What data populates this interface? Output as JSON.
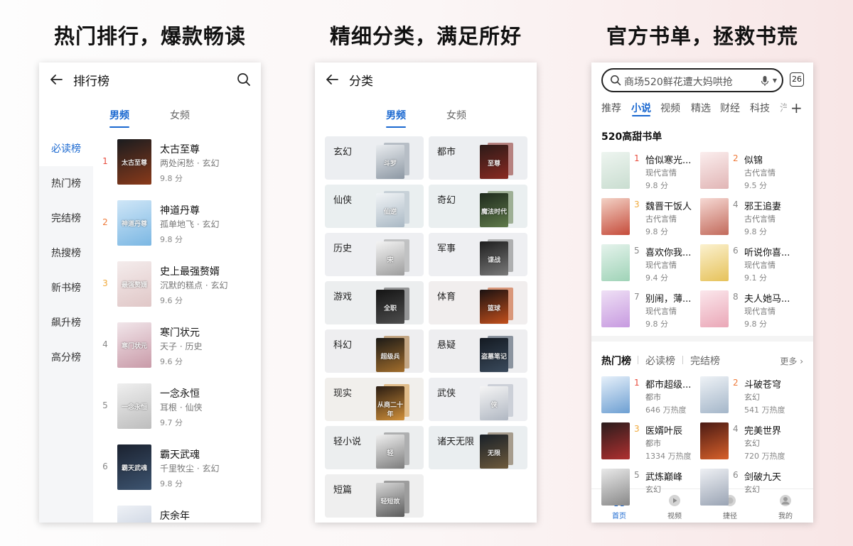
{
  "headlines": [
    "热门排行，爆款畅读",
    "精细分类，满足所好",
    "官方书单，拯救书荒"
  ],
  "ranking": {
    "title": "排行榜",
    "tabs": [
      "男频",
      "女频"
    ],
    "sidebar": [
      "必读榜",
      "热门榜",
      "完结榜",
      "热搜榜",
      "新书榜",
      "飙升榜",
      "高分榜"
    ],
    "books": [
      {
        "rank": "1",
        "title": "太古至尊",
        "meta": "两处闲愁 · 玄幻",
        "score": "9.8 分",
        "cover_text": "太古至尊",
        "colors": [
          "#1a1c1f",
          "#8a3a1a"
        ]
      },
      {
        "rank": "2",
        "title": "神道丹尊",
        "meta": "孤单地飞 · 玄幻",
        "score": "9.8 分",
        "cover_text": "神道丹尊",
        "colors": [
          "#cfe6f7",
          "#7bb7e3"
        ]
      },
      {
        "rank": "3",
        "title": "史上最强赘婿",
        "meta": "沉默的糕点 · 玄幻",
        "score": "9.6 分",
        "cover_text": "最强赘婿",
        "colors": [
          "#f4ecec",
          "#e0c7c7"
        ]
      },
      {
        "rank": "4",
        "title": "寒门状元",
        "meta": "天子 · 历史",
        "score": "9.6 分",
        "cover_text": "寒门状元",
        "colors": [
          "#f1e6ea",
          "#c99aa8"
        ]
      },
      {
        "rank": "5",
        "title": "一念永恒",
        "meta": "耳根 · 仙侠",
        "score": "9.7 分",
        "cover_text": "一念永恒",
        "colors": [
          "#efefef",
          "#bdbdbd"
        ]
      },
      {
        "rank": "6",
        "title": "霸天武魂",
        "meta": "千里牧尘 · 玄幻",
        "score": "9.8 分",
        "cover_text": "霸天武魂",
        "colors": [
          "#1b2230",
          "#3d5470"
        ]
      },
      {
        "rank": "",
        "title": "庆余年",
        "meta": "",
        "score": "",
        "cover_text": "庆余年",
        "colors": [
          "#eef1f6",
          "#b9c4d6"
        ]
      }
    ]
  },
  "category": {
    "title": "分类",
    "tabs": [
      "男频",
      "女频"
    ],
    "items": [
      {
        "name": "玄幻",
        "bg": "#eceef1",
        "cover_text": "斗罗",
        "colors": [
          "#e9ecef",
          "#8c97a3"
        ]
      },
      {
        "name": "都市",
        "bg": "#eceef1",
        "cover_text": "至尊",
        "colors": [
          "#2b1a18",
          "#8a2a22"
        ]
      },
      {
        "name": "仙侠",
        "bg": "#eaeff0",
        "cover_text": "仙逆",
        "colors": [
          "#f1f4f6",
          "#a9b8c4"
        ]
      },
      {
        "name": "奇幻",
        "bg": "#eaeff0",
        "cover_text": "魔法时代",
        "colors": [
          "#1e2a1d",
          "#5f7a4a"
        ]
      },
      {
        "name": "历史",
        "bg": "#eeeff2",
        "cover_text": "宋",
        "colors": [
          "#f3f3f3",
          "#9d9d9d"
        ]
      },
      {
        "name": "军事",
        "bg": "#eeeff2",
        "cover_text": "谍战",
        "colors": [
          "#1e1e1e",
          "#7a7a7a"
        ]
      },
      {
        "name": "游戏",
        "bg": "#eceeef",
        "cover_text": "全职",
        "colors": [
          "#141414",
          "#4e4e4e"
        ]
      },
      {
        "name": "体育",
        "bg": "#f1eeee",
        "cover_text": "篮球",
        "colors": [
          "#1a1111",
          "#c4501c"
        ]
      },
      {
        "name": "科幻",
        "bg": "#eeeef0",
        "cover_text": "超级兵",
        "colors": [
          "#1c1a17",
          "#a36e2c"
        ]
      },
      {
        "name": "悬疑",
        "bg": "#eeeef0",
        "cover_text": "盗墓笔记",
        "colors": [
          "#141a22",
          "#3a4a5c"
        ]
      },
      {
        "name": "现实",
        "bg": "#f1efec",
        "cover_text": "从商二十年",
        "colors": [
          "#2a1c12",
          "#d2913a"
        ]
      },
      {
        "name": "武侠",
        "bg": "#eeeff2",
        "cover_text": "侠",
        "colors": [
          "#f5f5f5",
          "#b0b7c2"
        ]
      },
      {
        "name": "轻小说",
        "bg": "#eceeef",
        "cover_text": "轻",
        "colors": [
          "#f0f0f0",
          "#7c7c7c"
        ]
      },
      {
        "name": "诸天无限",
        "bg": "#eaeef0",
        "cover_text": "无限",
        "colors": [
          "#182028",
          "#6e5a3c"
        ]
      },
      {
        "name": "短篇",
        "bg": "#efefef",
        "cover_text": "轻短故",
        "colors": [
          "#d8d8d8",
          "#5a5a5a"
        ]
      }
    ]
  },
  "store": {
    "search_text": "商场520鲜花遭大妈哄抢",
    "day_badge": "26",
    "tabs": [
      "推荐",
      "小说",
      "视频",
      "精选",
      "财经",
      "科技",
      "汽"
    ],
    "active_tab": 1,
    "section_title": "520高甜书单",
    "sweet_books": [
      {
        "rank": "1",
        "title": "恰似寒光...",
        "meta": "现代言情",
        "score": "9.8 分",
        "colors": [
          "#eef5f0",
          "#c9ddd0"
        ]
      },
      {
        "rank": "2",
        "title": "似锦",
        "meta": "古代言情",
        "score": "9.5 分",
        "colors": [
          "#fbeeee",
          "#e1b5b5"
        ]
      },
      {
        "rank": "3",
        "title": "魏晋干饭人",
        "meta": "古代言情",
        "score": "9.8 分",
        "colors": [
          "#f3d2c6",
          "#c54b3a"
        ]
      },
      {
        "rank": "4",
        "title": "邪王追妻",
        "meta": "古代言情",
        "score": "9.8 分",
        "colors": [
          "#f6d9d4",
          "#c26a5b"
        ]
      },
      {
        "rank": "5",
        "title": "喜欢你我...",
        "meta": "现代言情",
        "score": "9.4 分",
        "colors": [
          "#e5f3ec",
          "#9fd3b7"
        ]
      },
      {
        "rank": "6",
        "title": "听说你喜...",
        "meta": "现代言情",
        "score": "9.1 分",
        "colors": [
          "#fbf1cf",
          "#e6c25a"
        ]
      },
      {
        "rank": "7",
        "title": "别闹，薄...",
        "meta": "现代言情",
        "score": "9.8 分",
        "colors": [
          "#efe0f5",
          "#c79ae0"
        ]
      },
      {
        "rank": "8",
        "title": "夫人她马...",
        "meta": "现代言情",
        "score": "9.8 分",
        "colors": [
          "#fbe7ec",
          "#eaa7b7"
        ]
      }
    ],
    "subtabs": [
      "热门榜",
      "必读榜",
      "完结榜"
    ],
    "more": "更多",
    "hot_books": [
      {
        "rank": "1",
        "title": "都市超级...",
        "meta": "都市",
        "score": "646 万热度",
        "colors": [
          "#e6f0fa",
          "#6d9fd2"
        ]
      },
      {
        "rank": "2",
        "title": "斗破苍穹",
        "meta": "玄幻",
        "score": "541 万热度",
        "colors": [
          "#eef2f6",
          "#a4b6c9"
        ]
      },
      {
        "rank": "3",
        "title": "医婿叶辰",
        "meta": "都市",
        "score": "1334 万热度",
        "colors": [
          "#2a1c1c",
          "#b03030"
        ]
      },
      {
        "rank": "4",
        "title": "完美世界",
        "meta": "玄幻",
        "score": "720 万热度",
        "colors": [
          "#4a1a14",
          "#d8602a"
        ]
      },
      {
        "rank": "5",
        "title": "武炼巅峰",
        "meta": "玄幻",
        "score": "",
        "colors": [
          "#e9e9e9",
          "#888888"
        ]
      },
      {
        "rank": "6",
        "title": "剑破九天",
        "meta": "玄幻",
        "score": "",
        "colors": [
          "#eef0f4",
          "#9aa4b4"
        ]
      }
    ],
    "nav": [
      "首页",
      "视频",
      "捷径",
      "我的"
    ]
  }
}
